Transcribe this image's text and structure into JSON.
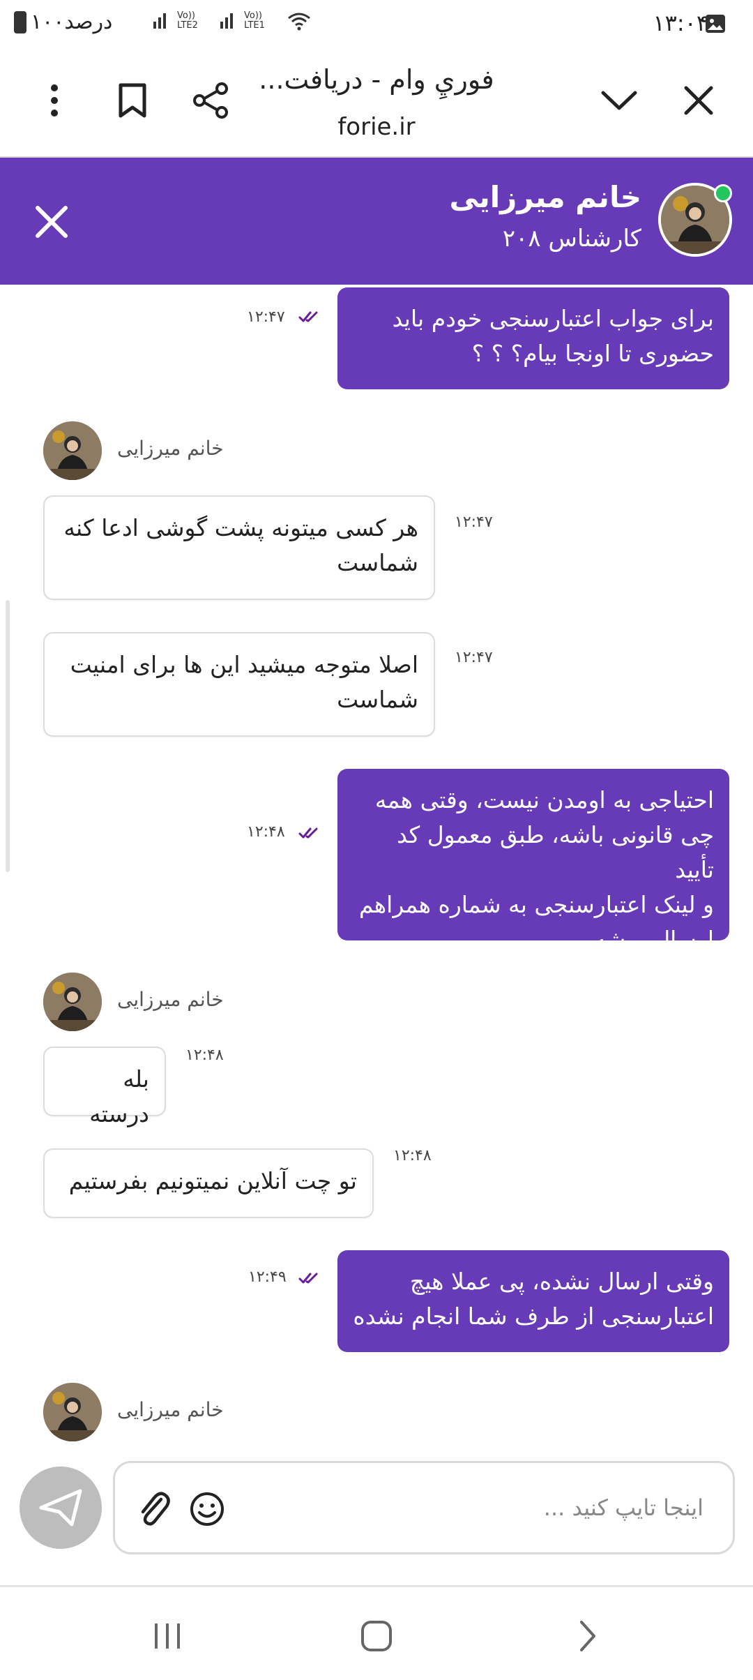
{
  "status_bar": {
    "time": "۱۳:۰۴",
    "battery": "۱۰۰درصد",
    "net_1": "Vo)) LTE2",
    "net_2": "Vo)) LTE1"
  },
  "browser": {
    "title": "فوريِ وام - دريافت...",
    "url": "forie.ir",
    "icons": [
      "close-icon",
      "chevron-down-icon",
      "share-icon",
      "bookmark-icon",
      "more-vert-icon"
    ]
  },
  "chat_header": {
    "agent_name": "خانم میرزایی",
    "agent_role": "کارشناس ۲۰۸",
    "status": "online"
  },
  "messages": [
    {
      "id": "m1",
      "direction": "out",
      "time": "۱۲:۴۷",
      "text_lines": [
        "برای جواب اعتبارسنجی خودم باید",
        "حضوری تا اونجا بیام؟ ؟ ؟"
      ]
    },
    {
      "id": "s1",
      "type": "sender",
      "name": "خانم میرزایی"
    },
    {
      "id": "m2",
      "direction": "in",
      "time": "۱۲:۴۷",
      "text_lines": [
        "هر کسی میتونه پشت گوشی ادعا کنه",
        "شماست"
      ]
    },
    {
      "id": "m3",
      "direction": "in",
      "time": "۱۲:۴۷",
      "text_lines": [
        "اصلا متوجه میشید این ها برای امنیت",
        "شماست"
      ]
    },
    {
      "id": "m4",
      "direction": "out",
      "time": "۱۲:۴۸",
      "text_lines": [
        "احتیاجی به اومدن نیست، وقتی همه",
        "چی قانونی باشه، طبق معمول کد تأیید",
        "و لینک اعتبارسنجی به شماره همراهم",
        "ارسال میشه"
      ]
    },
    {
      "id": "s2",
      "type": "sender",
      "name": "خانم میرزایی"
    },
    {
      "id": "m5",
      "direction": "in",
      "time": "۱۲:۴۸",
      "text_lines": [
        "بله درسته"
      ]
    },
    {
      "id": "m6",
      "direction": "in",
      "time": "۱۲:۴۸",
      "text_lines": [
        "تو چت آنلاین نمیتونیم بفرستیم"
      ]
    },
    {
      "id": "m7",
      "direction": "out",
      "time": "۱۲:۴۹",
      "text_lines": [
        "وقتی ارسال نشده، پی عملا هیچ",
        "اعتبارسنجی از طرف شما انجام نشده"
      ]
    },
    {
      "id": "s3",
      "type": "sender",
      "name": "خانم میرزایی"
    }
  ],
  "composer": {
    "placeholder": "اینجا تایپ کنید ...",
    "value": ""
  },
  "colors": {
    "brand": "#673ab7",
    "read_ticks": "#6a1b9a",
    "online": "#22c55e",
    "send_button": "#bdbdbd"
  },
  "nav_bar": [
    "recents-icon",
    "home-icon",
    "back-icon"
  ]
}
